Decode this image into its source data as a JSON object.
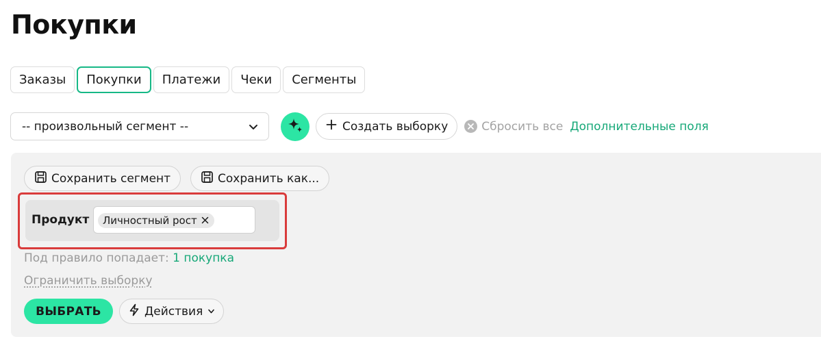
{
  "page": {
    "title": "Покупки"
  },
  "tabs": [
    {
      "label": "Заказы",
      "active": false
    },
    {
      "label": "Покупки",
      "active": true
    },
    {
      "label": "Платежи",
      "active": false
    },
    {
      "label": "Чеки",
      "active": false
    },
    {
      "label": "Сегменты",
      "active": false
    }
  ],
  "toolbar": {
    "segment_select_value": "-- произвольный сегмент --",
    "ai_icon": "sparkles-icon",
    "create_label": "Создать выборку",
    "reset_label": "Сбросить все",
    "extra_fields_label": "Дополнительные поля"
  },
  "filter": {
    "save_segment_label": "Сохранить сегмент",
    "save_as_label": "Сохранить как...",
    "rule": {
      "label": "Продукт",
      "chip": "Личностный рост"
    },
    "count_prefix": "Под правило попадает:",
    "count_link": "1 покупка",
    "limit_label": "Ограничить выборку",
    "choose_label": "ВЫБРАТЬ",
    "actions_label": "Действия"
  },
  "colors": {
    "accent": "#2ce5a4",
    "link": "#16a878",
    "highlight": "#d93b3b",
    "panel": "#f2f2f2"
  }
}
